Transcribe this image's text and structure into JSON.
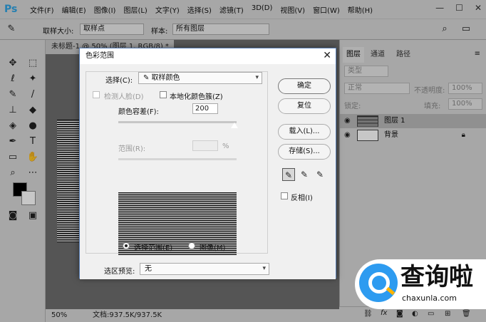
{
  "app": {
    "logo": "Ps"
  },
  "menu": [
    "文件(F)",
    "编辑(E)",
    "图像(I)",
    "图层(L)",
    "文字(Y)",
    "选择(S)",
    "滤镜(T)",
    "3D(D)",
    "视图(V)",
    "窗口(W)",
    "帮助(H)"
  ],
  "window_controls": {
    "minimize": "—",
    "restore": "☐",
    "close": "✕"
  },
  "options_bar": {
    "sample_size_label": "取样大小:",
    "sample_size_value": "取样点",
    "sample_label": "样本:",
    "sample_value": "所有图层"
  },
  "document": {
    "tab_title": "未标题-1 @ 50% (图层 1, RGB/8) *",
    "zoom": "50%",
    "doc_info": "文档:937.5K/937.5K"
  },
  "panel": {
    "tabs": [
      "图层",
      "通道",
      "路径"
    ],
    "filter_kind": "类型",
    "blend_mode": "正常",
    "opacity_label": "不透明度:",
    "opacity_value": "100%",
    "lock_label": "锁定:",
    "fill_label": "填充:",
    "fill_value": "100%",
    "layers": [
      {
        "name": "图层 1"
      },
      {
        "name": "背景"
      }
    ]
  },
  "dialog": {
    "title": "色彩范围",
    "select_label": "选择(C):",
    "select_value": "取样颜色",
    "detect_faces": "检测人脸(D)",
    "localized_clusters": "本地化颜色簇(Z)",
    "fuzziness_label": "颜色容差(F):",
    "fuzziness_value": "200",
    "range_label": "范围(R):",
    "range_unit": "%",
    "radio_selection": "选择范围(E)",
    "radio_image": "图像(M)",
    "preview_label": "选区预览:",
    "preview_value": "无",
    "buttons": {
      "ok": "确定",
      "reset": "复位",
      "load": "载入(L)...",
      "save": "存储(S)..."
    },
    "invert": "反相(I)"
  },
  "watermark": {
    "text": "查询啦",
    "url": "chaxunla.com"
  }
}
